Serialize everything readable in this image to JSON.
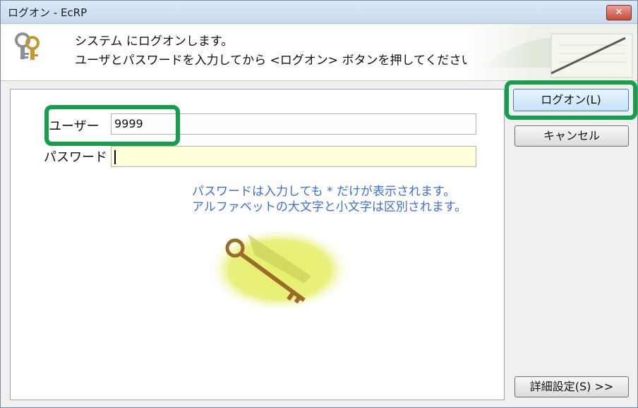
{
  "window": {
    "title": "ログオン - EcRP",
    "close_glyph": "✕"
  },
  "header": {
    "icon": "keys-icon",
    "line1": "システム にログオンします。",
    "line2": "ユーザとパスワードを入力してから <ログオン> ボタンを押してください。"
  },
  "form": {
    "user_label": "ユーザー",
    "user_value": "9999",
    "password_label": "パスワード",
    "password_value": "",
    "hint_line1": "パスワードは入力しても * だけが表示されます。",
    "hint_line2": "アルファベットの大文字と小文字は区別されます。"
  },
  "buttons": {
    "logon": "ログオン(L)",
    "cancel": "キャンセル",
    "details": "詳細設定(S) >>"
  },
  "colors": {
    "highlight": "#14a04a",
    "hint_text": "#3d6fd8",
    "password_bg": "#ffffd8"
  }
}
